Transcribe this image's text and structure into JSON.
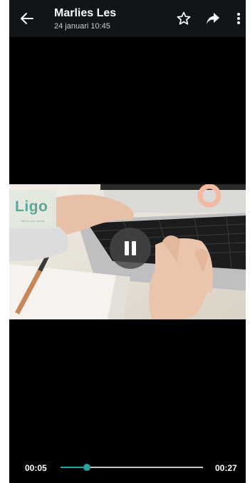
{
  "header": {
    "title": "Marlies Les",
    "subtitle": "24 januari 10:45",
    "icons": [
      "back-arrow-icon",
      "star-icon",
      "share-icon",
      "more-vert-icon"
    ]
  },
  "video": {
    "logo_text": "Ligo",
    "logo_tagline": "Talk to your friends",
    "state": "playing"
  },
  "player": {
    "current_time": "00:05",
    "total_time": "00:27",
    "progress_fraction": 0.185,
    "accent_color": "#2aa39d"
  }
}
